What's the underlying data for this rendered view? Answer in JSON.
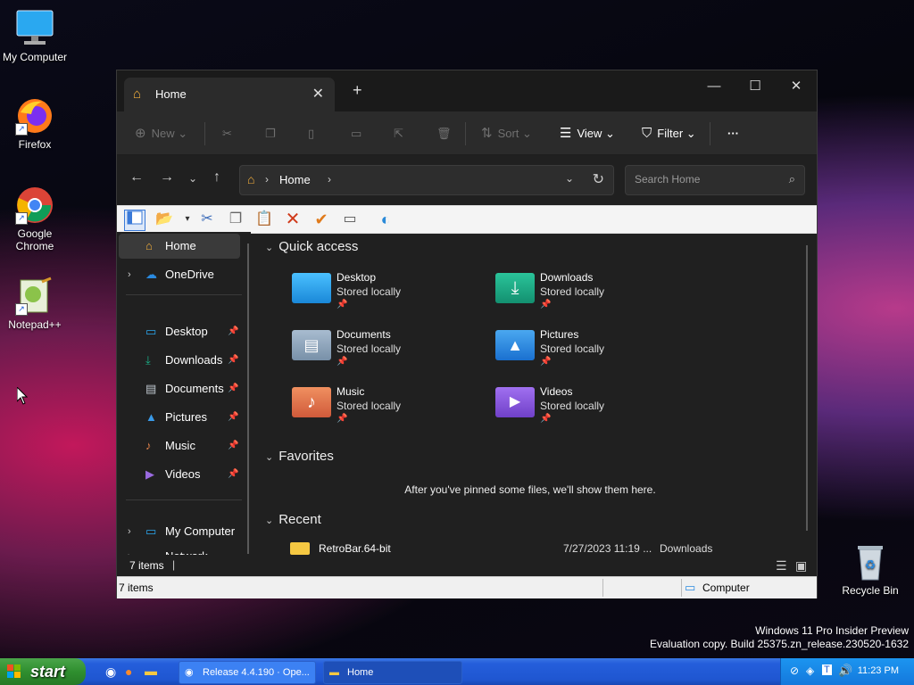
{
  "desktop": {
    "icons": [
      {
        "label": "My Computer"
      },
      {
        "label": "Firefox"
      },
      {
        "label": "Google Chrome"
      },
      {
        "label": "Notepad++"
      },
      {
        "label": "Recycle Bin"
      }
    ],
    "watermark": {
      "line1": "Windows 11 Pro Insider Preview",
      "line2": "Evaluation copy. Build 25375.zn_release.230520-1632"
    }
  },
  "explorer": {
    "tab": {
      "label": "Home",
      "close": "✕"
    },
    "new_tab": "+",
    "window_controls": {
      "minimize": "—",
      "maximize": "☐",
      "close": "✕"
    },
    "toolbar": {
      "new_label": "New",
      "sort_label": "Sort",
      "view_label": "View",
      "filter_label": "Filter",
      "more_label": "···"
    },
    "address": {
      "location": "Home"
    },
    "search": {
      "placeholder": "Search Home"
    },
    "sidebar": {
      "home": "Home",
      "onedrive": "OneDrive",
      "pinned": [
        {
          "label": "Desktop"
        },
        {
          "label": "Downloads"
        },
        {
          "label": "Documents"
        },
        {
          "label": "Pictures"
        },
        {
          "label": "Music"
        },
        {
          "label": "Videos"
        }
      ],
      "my_computer": "My Computer",
      "network": "Network"
    },
    "quick_access": {
      "title": "Quick access",
      "folders": [
        {
          "name": "Desktop",
          "sub": "Stored locally",
          "color": "#1a9be8"
        },
        {
          "name": "Downloads",
          "sub": "Stored locally",
          "color": "#1aa37a"
        },
        {
          "name": "Documents",
          "sub": "Stored locally",
          "color": "#8aa4c0"
        },
        {
          "name": "Pictures",
          "sub": "Stored locally",
          "color": "#2a8ee0"
        },
        {
          "name": "Music",
          "sub": "Stored locally",
          "color": "#e0704a"
        },
        {
          "name": "Videos",
          "sub": "Stored locally",
          "color": "#8a5ad8"
        }
      ]
    },
    "favorites": {
      "title": "Favorites",
      "empty": "After you've pinned some files, we'll show them here."
    },
    "recent": {
      "title": "Recent",
      "items": [
        {
          "name": "RetroBar.64-bit",
          "date": "7/27/2023 11:19 ...",
          "location": "Downloads"
        }
      ]
    },
    "status": {
      "items_dark": "7 items",
      "items_light": "7 items",
      "location": "Computer"
    }
  },
  "taskbar": {
    "start": "start",
    "tasks": [
      {
        "label": "Release 4.4.190 · Ope..."
      },
      {
        "label": "Home"
      }
    ],
    "clock": "11:23 PM"
  }
}
